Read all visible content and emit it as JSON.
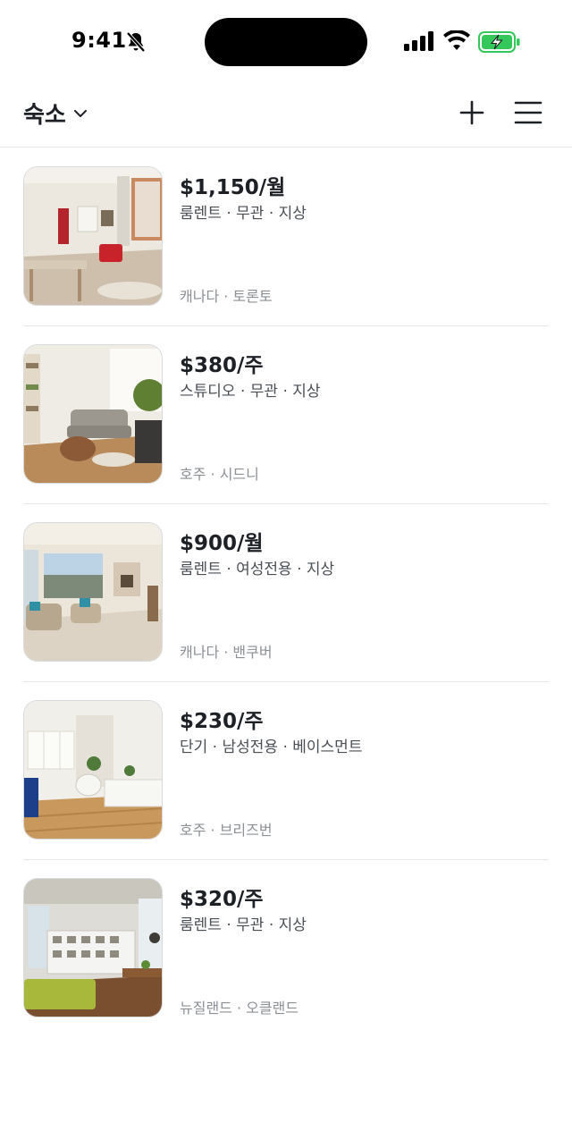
{
  "status_bar": {
    "time": "9:41"
  },
  "header": {
    "title": "숙소"
  },
  "listings": [
    {
      "price": "$1,150/월",
      "tags": "룸렌트 · 무관 · 지상",
      "location": "캐나다 · 토론토"
    },
    {
      "price": "$380/주",
      "tags": "스튜디오 · 무관 · 지상",
      "location": "호주 · 시드니"
    },
    {
      "price": "$900/월",
      "tags": "룸렌트 · 여성전용 · 지상",
      "location": "캐나다 · 밴쿠버"
    },
    {
      "price": "$230/주",
      "tags": "단기 · 남성전용 · 베이스먼트",
      "location": "호주 · 브리즈번"
    },
    {
      "price": "$320/주",
      "tags": "룸렌트 · 무관 · 지상",
      "location": "뉴질랜드 · 오클랜드"
    }
  ],
  "colors": {
    "text_primary": "#1d2126",
    "text_secondary": "#4a4f55",
    "text_muted": "#8c9196",
    "divider": "#e4e6e9",
    "battery_charging": "#34c759"
  }
}
